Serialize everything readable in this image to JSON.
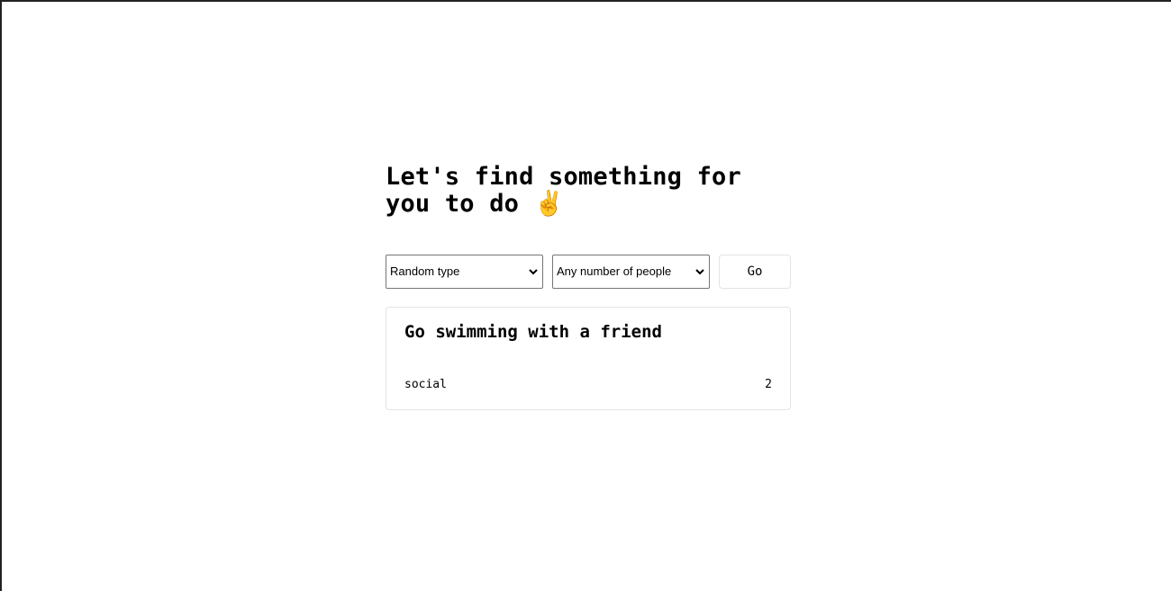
{
  "heading": {
    "text": "Let's find something for you to do",
    "emoji": "✌️"
  },
  "controls": {
    "type_select": {
      "selected": "Random type",
      "options": [
        "Random type"
      ]
    },
    "people_select": {
      "selected": "Any number of people",
      "options": [
        "Any number of people"
      ]
    },
    "go_label": "Go"
  },
  "activity": {
    "title": "Go swimming with a friend",
    "type": "social",
    "participants": "2"
  }
}
